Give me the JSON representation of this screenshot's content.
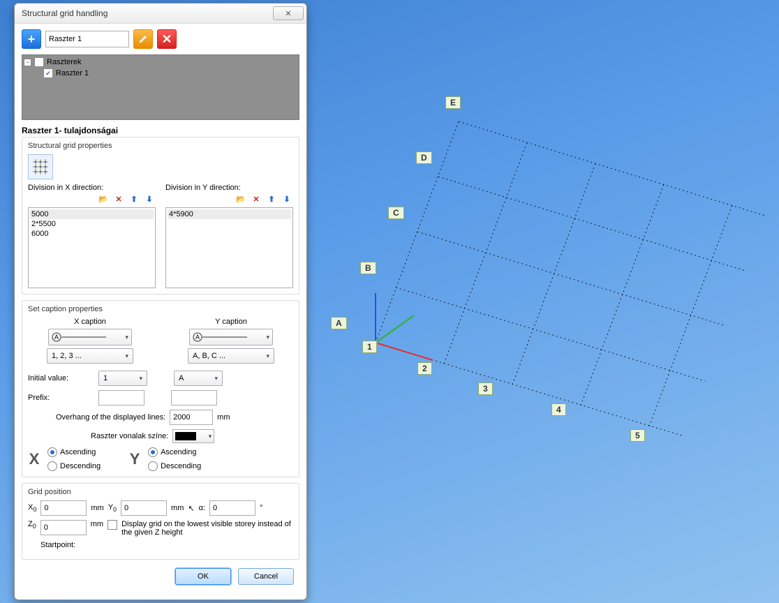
{
  "window": {
    "title": "Structural grid handling"
  },
  "toolbar": {
    "raster_name": "Raszter 1"
  },
  "tree": {
    "root_label": "Raszterek",
    "child_label": "Raszter 1",
    "child_checked": true
  },
  "section": {
    "properties_title": "Raszter 1- tulajdonságai"
  },
  "structural_grid": {
    "legend": "Structural grid properties",
    "x_label": "Division in X direction:",
    "y_label": "Division in Y direction:",
    "x_items": [
      "5000",
      "2*5500",
      "6000"
    ],
    "y_items": [
      "4*5900"
    ]
  },
  "caption": {
    "legend": "Set caption properties",
    "x_title": "X caption",
    "y_title": "Y caption",
    "x_sequence": "1, 2, 3 ...",
    "y_sequence": "A, B, C ...",
    "initial_label": "Initial value:",
    "x_initial": "1",
    "y_initial": "A",
    "prefix_label": "Prefix:",
    "x_prefix": "",
    "y_prefix": "",
    "overhang_label": "Overhang of the displayed lines:",
    "overhang_value": "2000",
    "overhang_unit": "mm",
    "linecolor_label": "Raszter vonalak színe:",
    "ascending": "Ascending",
    "descending": "Descending",
    "x_dir": "ascending",
    "y_dir": "ascending"
  },
  "gridpos": {
    "legend": "Grid position",
    "x0": "0",
    "y0": "0",
    "z0": "0",
    "alpha": "0",
    "unit": "mm",
    "deg": "°",
    "checkbox_label": "Display grid on the lowest visible storey instead of the given Z height",
    "startpoint_label": "Startpoint:"
  },
  "footer": {
    "ok": "OK",
    "cancel": "Cancel"
  },
  "viewport": {
    "x_labels": [
      "1",
      "2",
      "3",
      "4",
      "5"
    ],
    "y_labels": [
      "A",
      "B",
      "C",
      "D",
      "E"
    ]
  }
}
